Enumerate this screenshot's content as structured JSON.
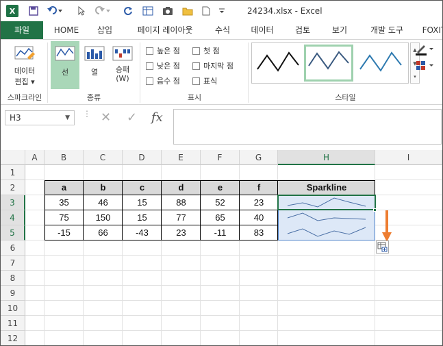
{
  "app": {
    "title": "24234.xlsx - Excel"
  },
  "tabs": [
    {
      "label": "파일",
      "active": false,
      "file": true
    },
    {
      "label": "HOME",
      "active": false
    },
    {
      "label": "삽입",
      "active": false
    },
    {
      "label": "페이지 레이아웃",
      "active": false
    },
    {
      "label": "수식",
      "active": false
    },
    {
      "label": "데이터",
      "active": false
    },
    {
      "label": "검토",
      "active": false
    },
    {
      "label": "보기",
      "active": false
    },
    {
      "label": "개발 도구",
      "active": true
    },
    {
      "label": "FOXIT",
      "active": false
    }
  ],
  "ribbon": {
    "edit_data": {
      "line1": "데이터",
      "line2": "편집 ▾"
    },
    "group_sparkline": "스파크라인",
    "type_line": "선",
    "type_column": "열",
    "type_winloss": {
      "line1": "승패",
      "line2": "(W)"
    },
    "group_type": "종류",
    "checks": {
      "high": "높은 점",
      "first": "첫 점",
      "low": "낮은 점",
      "last": "마지막 점",
      "negative": "음수 점",
      "markers": "표식"
    },
    "group_show": "표시",
    "group_style": "스타일"
  },
  "formula_bar": {
    "name_box": "H3",
    "formula": ""
  },
  "columns": [
    "A",
    "B",
    "C",
    "D",
    "E",
    "F",
    "G",
    "H",
    "I"
  ],
  "rows": [
    "1",
    "2",
    "3",
    "4",
    "5",
    "6",
    "7",
    "8",
    "9",
    "10",
    "11",
    "12"
  ],
  "table": {
    "headers": [
      "a",
      "b",
      "c",
      "d",
      "e",
      "f",
      "Sparkline"
    ],
    "data": [
      [
        "35",
        "46",
        "15",
        "88",
        "52",
        "23"
      ],
      [
        "75",
        "150",
        "15",
        "77",
        "65",
        "40"
      ],
      [
        "-15",
        "66",
        "-43",
        "23",
        "-11",
        "83"
      ]
    ]
  },
  "colors": {
    "excel_green": "#217346",
    "selection_fill": "#dde8f7",
    "sparkline": "#4a6fa5",
    "arrow": "#ed7d31"
  }
}
